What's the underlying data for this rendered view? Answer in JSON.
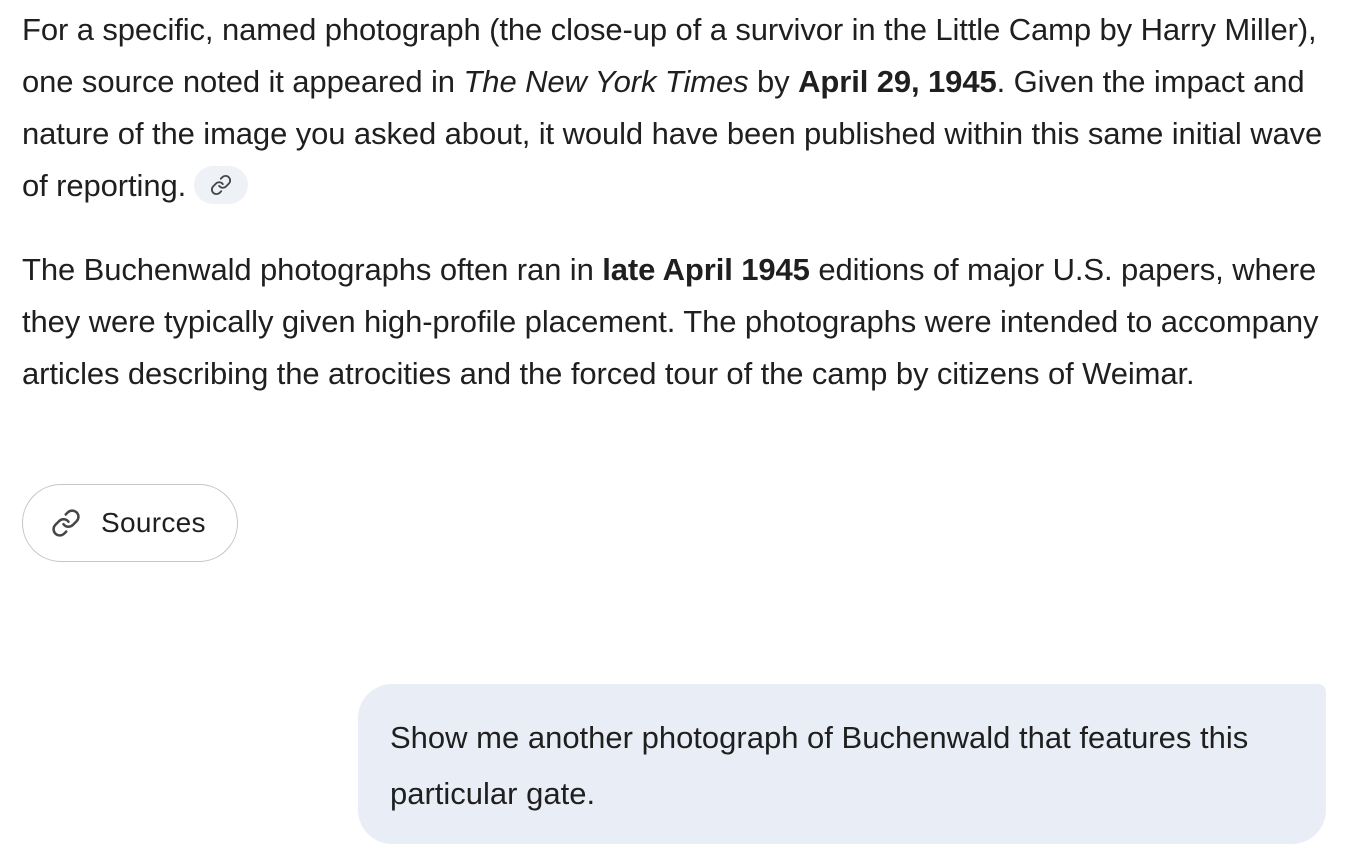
{
  "response": {
    "paragraph1": {
      "t1": "For a specific, named photograph (the close-up of a survivor in the Little Camp by Harry Miller), one source noted it appeared in ",
      "italic1": "The New York Times",
      "t2": " by ",
      "bold1": "April 29, 1945",
      "t3": ". Given the impact and nature of the image you asked about, it would have been published within this same initial wave of reporting."
    },
    "paragraph2": {
      "t1": "The Buchenwald photographs often ran in ",
      "bold1": "late April 1945",
      "t2": " editions of major U.S. papers, where they were typically given high-profile placement. The photographs were intended to accompany articles describing the atrocities and the forced tour of the camp by citizens of Weimar."
    },
    "citation_icon": "link-icon",
    "sources_button": {
      "label": "Sources",
      "icon": "link-icon"
    }
  },
  "user_message": {
    "text": "Show me another photograph of Buchenwald that features this particular gate."
  },
  "colors": {
    "text": "#1f1f1f",
    "user_bubble_bg": "#e9eef6",
    "chip_bg": "#eef1f6",
    "button_border": "#c4c7c5"
  }
}
